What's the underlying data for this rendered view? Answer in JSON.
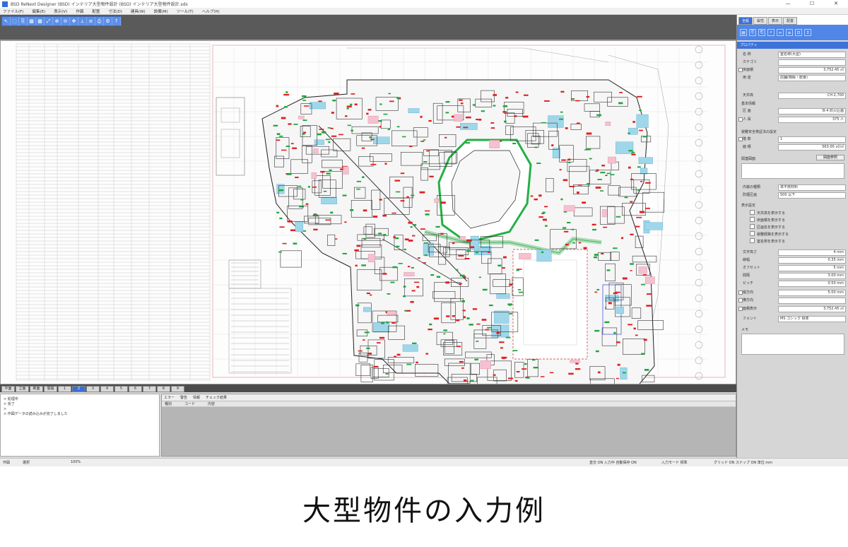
{
  "window": {
    "title": "BSD ReNext Designer (BSD) インテリア大型物件設計 (BSD) インテリア大型物件設計.sdx",
    "controls": [
      "—",
      "☐",
      "✕"
    ]
  },
  "menu": [
    "ファイル(F)",
    "編集(E)",
    "表示(V)",
    "作図",
    "配置",
    "寸法(D)",
    "建具(W)",
    "設備(M)",
    "ツール(T)",
    "ヘルプ(H)"
  ],
  "toolbar": {
    "icons": [
      "pointer-icon",
      "select-icon",
      "copy-icon",
      "grid-icon",
      "grid-icon",
      "zoom-fit-icon",
      "zoom-in-icon",
      "zoom-out-icon",
      "pan-icon",
      "measure-icon",
      "layer-icon",
      "print-icon",
      "settings-icon",
      "help-icon"
    ],
    "glyphs": [
      "↖",
      "⬚",
      "⎘",
      "▦",
      "▦",
      "⤢",
      "⊕",
      "⊖",
      "✥",
      "⟂",
      "≡",
      "⎙",
      "⚙",
      "?"
    ]
  },
  "sheet_tabs": [
    "平面",
    "立面",
    "断面",
    "展開",
    "1",
    "2",
    "3",
    "4",
    "5",
    "6",
    "7",
    "8",
    "9"
  ],
  "active_sheet_index": 5,
  "log": {
    "lines": [
      "> 処理中",
      "> 完了",
      ">",
      "> 作図データの読み込みが完了しました"
    ]
  },
  "messages": {
    "tabs": [
      "エラー",
      "警告",
      "情報",
      "チェック結果"
    ],
    "columns": [
      "種別",
      "コード",
      "内容"
    ]
  },
  "status": {
    "left_1": "作図",
    "left_2": "選択",
    "left_3": "100%",
    "right_1": "直交 ON 入力中 自動保存 ON",
    "right_2": "入力モード 標準",
    "right_3": "グリッド ON スナップ ON 単位 mm"
  },
  "properties": {
    "tabs": [
      "全般",
      "属性",
      "表示",
      "配置"
    ],
    "title": "プロパティ",
    "rows": [
      {
        "label": "名 称",
        "value": "室名称(大型)"
      },
      {
        "label": "カテゴリ",
        "value": ""
      },
      {
        "label": "床面積",
        "value": "3,752.45 ㎡"
      },
      {
        "label": "用 途",
        "value": "店舗(物販・飲食)"
      },
      {
        "label": "天井高",
        "value": "CH 2,700"
      }
    ],
    "section_1": "基本情報",
    "rows2": [
      {
        "label": "区 画",
        "value": "B-4 防火区画"
      },
      {
        "label": "人 員",
        "value": "375 人"
      }
    ],
    "section_2": "避難安全検証法の設定",
    "rows3": [
      {
        "label": "階 数",
        "value": "1"
      },
      {
        "label": "面 積",
        "value": "563.00 ㎡/㎡"
      }
    ],
    "section_3": "関連図面",
    "button_label": "図面参照",
    "rows4": [
      {
        "label": "内装の種類",
        "value": "準不燃材料"
      },
      {
        "label": "防煙区画",
        "value": "500 以下"
      }
    ],
    "section_4": "表示設定",
    "options": [
      "天井高を表示する",
      "床面積を表示する",
      "区画名を表示する",
      "避難経路を表示する",
      "室名称を表示する"
    ],
    "dims": [
      {
        "label": "文字高さ",
        "value": "4 mm"
      },
      {
        "label": "線幅",
        "value": "0.35 mm"
      },
      {
        "label": "オフセット",
        "value": "5 mm"
      },
      {
        "label": "間隔",
        "value": "3.00 mm"
      },
      {
        "label": "ピッチ",
        "value": "0.50 mm"
      },
      {
        "label": "縦方向",
        "value": "5.00 mm"
      },
      {
        "label": "横方向",
        "value": ""
      },
      {
        "label": "面積表示",
        "value": "3,752.45 ㎡"
      }
    ],
    "font_label": "フォント",
    "font_value": "MS ゴシック 標準",
    "memo_label": "メモ"
  },
  "caption": "大型物件の入力例",
  "colors": {
    "accent": "#3a6fd8",
    "toolbar": "#5b8fe8",
    "drawing_red": "#e02020",
    "drawing_green": "#25b045",
    "drawing_cyan": "#6fc4e0"
  }
}
